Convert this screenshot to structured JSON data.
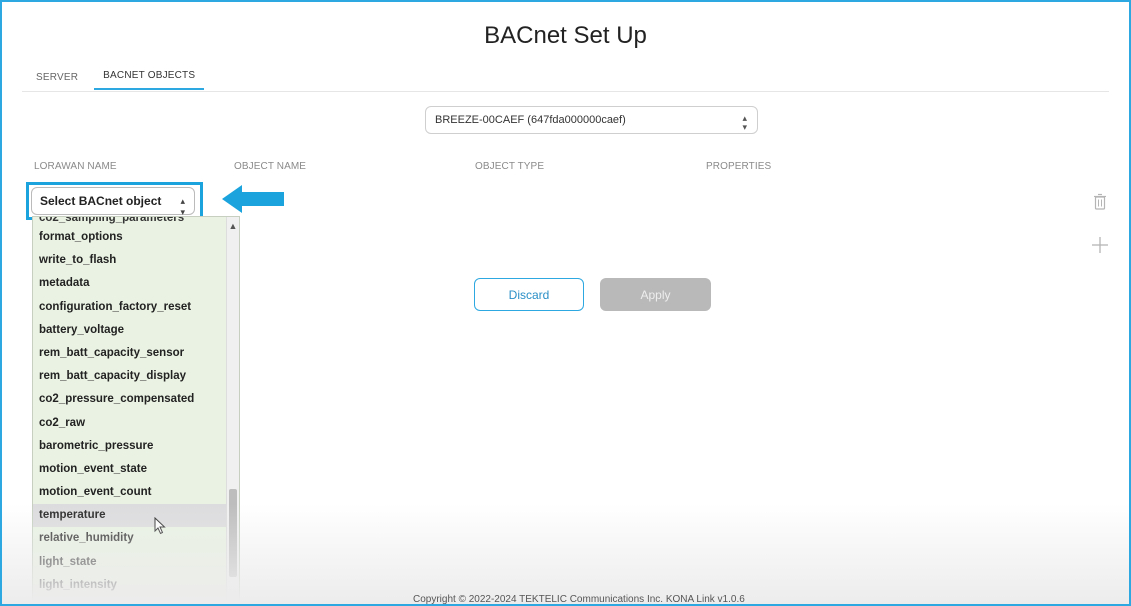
{
  "page": {
    "title": "BACnet Set Up"
  },
  "tabs": [
    {
      "label": "SERVER",
      "active": false
    },
    {
      "label": "BACNET OBJECTS",
      "active": true
    }
  ],
  "device_select": {
    "value": "BREEZE-00CAEF (647fda000000caef)"
  },
  "columns": {
    "lorawan_name": "LORAWAN NAME",
    "object_name": "OBJECT NAME",
    "object_type": "OBJECT TYPE",
    "properties": "PROPERTIES"
  },
  "object_select": {
    "value": "Select BACnet object"
  },
  "dropdown": {
    "partial_item": "co2_sampling_parameters",
    "items": [
      "format_options",
      "write_to_flash",
      "metadata",
      "configuration_factory_reset",
      "battery_voltage",
      "rem_batt_capacity_sensor",
      "rem_batt_capacity_display",
      "co2_pressure_compensated",
      "co2_raw",
      "barometric_pressure",
      "motion_event_state",
      "motion_event_count",
      "temperature",
      "relative_humidity",
      "light_state",
      "light_intensity"
    ],
    "hovered_item": "temperature"
  },
  "buttons": {
    "discard": "Discard",
    "apply": "Apply"
  },
  "icons": {
    "delete": "trash-icon",
    "add": "plus-icon",
    "pointer": "arrow-left-icon"
  },
  "colors": {
    "accent": "#2ea8e0",
    "dropdown_bg": "#eaf3e3",
    "apply_disabled": "#b9b9b9"
  },
  "footer": {
    "text": "Copyright © 2022-2024 TEKTELIC Communications Inc. KONA Link v1.0.6"
  }
}
